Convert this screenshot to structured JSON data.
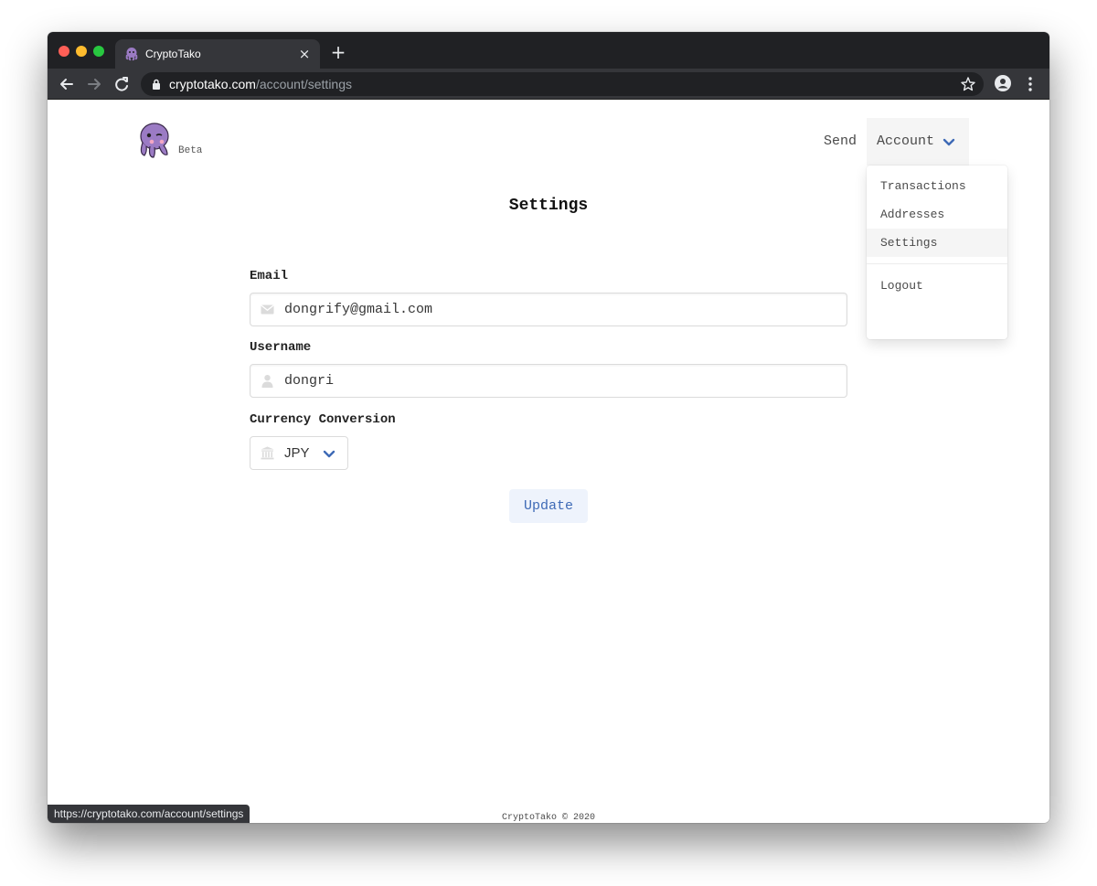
{
  "browser": {
    "tab_title": "CryptoTako",
    "close_glyph": "×",
    "new_tab_glyph": "+",
    "url_host": "cryptotako.com",
    "url_path": "/account/settings",
    "status_url": "https://cryptotako.com/account/settings"
  },
  "header": {
    "beta_label": "Beta",
    "nav_send": "Send",
    "nav_account": "Account"
  },
  "account_menu": {
    "items": [
      {
        "label": "Transactions"
      },
      {
        "label": "Addresses"
      },
      {
        "label": "Settings",
        "active": true
      }
    ],
    "logout": "Logout"
  },
  "settings": {
    "title": "Settings",
    "email_label": "Email",
    "email_value": "dongrify@gmail.com",
    "username_label": "Username",
    "username_value": "dongri",
    "currency_label": "Currency Conversion",
    "currency_value": "JPY",
    "update_label": "Update"
  },
  "footer": {
    "text": "CryptoTako © 2020"
  },
  "colors": {
    "accent": "#3e6ab6",
    "chrome_dark": "#202124",
    "chrome_mid": "#35363a",
    "logo_purple": "#9b7bc4"
  },
  "icons": {
    "email": "envelope-icon",
    "username": "user-icon",
    "currency": "bank-icon",
    "dropdown": "chevron-down-icon"
  }
}
